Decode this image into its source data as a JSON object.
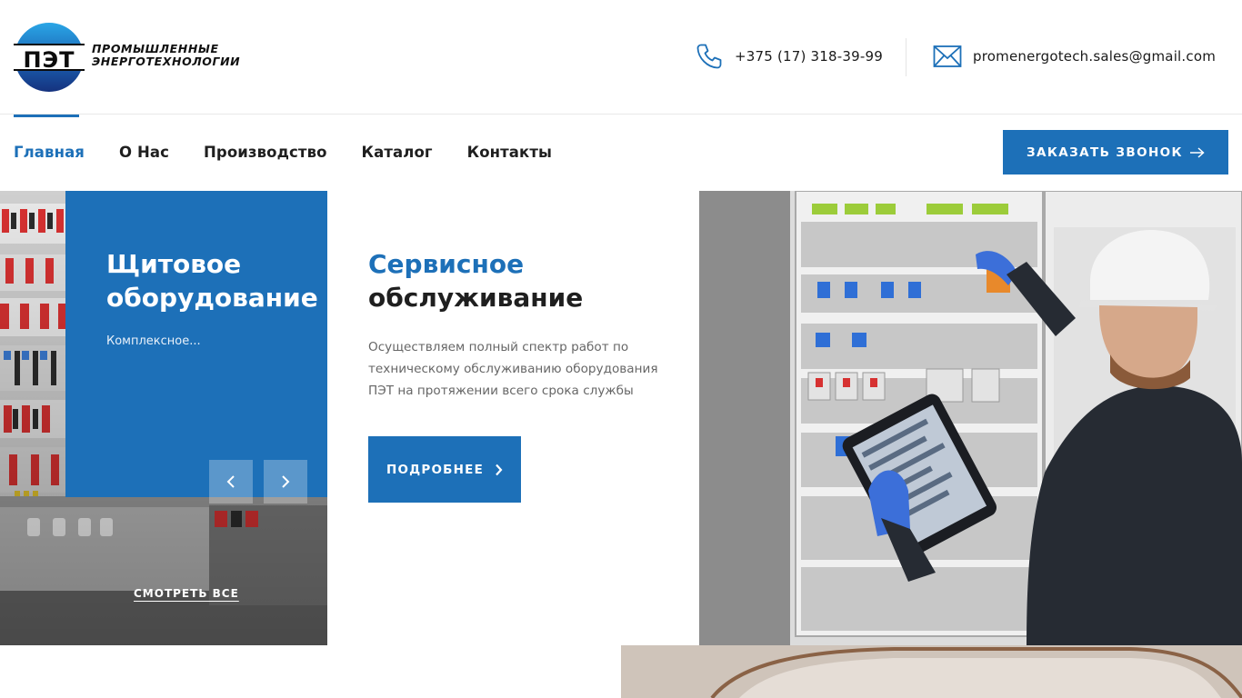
{
  "brand": {
    "logo_letters": "ПЭТ",
    "name_line1": "ПРОМЫШЛЕННЫЕ",
    "name_line2": "ЭНЕРГОТЕХНОЛОГИИ"
  },
  "contacts": {
    "phone": "+375 (17) 318-39-99",
    "email": "promenergotech.sales@gmail.com",
    "phone_icon": "phone-icon",
    "email_icon": "envelope-icon"
  },
  "nav": {
    "items": [
      {
        "label": "Главная",
        "active": true
      },
      {
        "label": "О Нас",
        "active": false
      },
      {
        "label": "Производство",
        "active": false
      },
      {
        "label": "Каталог",
        "active": false
      },
      {
        "label": "Контакты",
        "active": false
      }
    ],
    "cta_label": "ЗАКАЗАТЬ ЗВОНОК"
  },
  "slider": {
    "card_title": "Щитовое оборудование",
    "card_text": "Комплексное...",
    "see_all_label": "СМОТРЕТЬ ВСЕ"
  },
  "service": {
    "title_accent": "Сервисное",
    "title_rest": "обслуживание",
    "description": "Осуществляем полный спектр работ по техническому обслуживанию оборудования ПЭТ на протяжении всего срока службы",
    "button_label": "ПОДРОБНЕЕ"
  },
  "colors": {
    "accent": "#1d70b8",
    "text": "#1f1f1f",
    "muted": "#666666"
  }
}
